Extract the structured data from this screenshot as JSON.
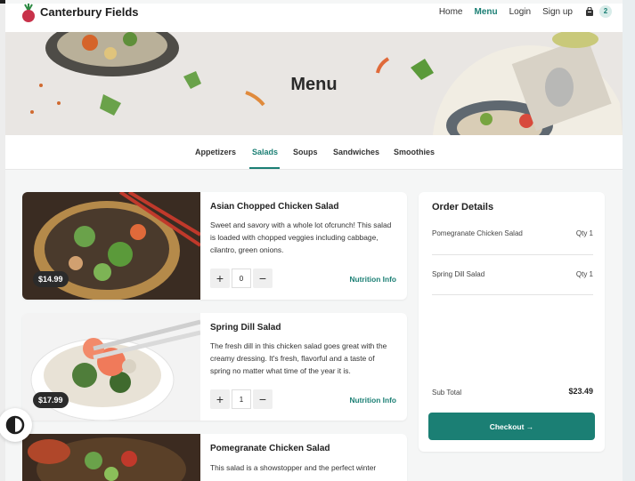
{
  "brand": {
    "name": "Canterbury Fields"
  },
  "nav": {
    "items": [
      "Home",
      "Menu",
      "Login",
      "Sign up"
    ],
    "active": "Menu",
    "cart_count": "2"
  },
  "hero": {
    "title": "Menu"
  },
  "tabs": {
    "items": [
      "Appetizers",
      "Salads",
      "Soups",
      "Sandwiches",
      "Smoothies"
    ],
    "active": "Salads"
  },
  "items": [
    {
      "title": "Asian Chopped Chicken Salad",
      "description": "Sweet and savory with a whole lot ofcrunch! This salad is loaded with chopped veggies including cabbage, cilantro, green onions.",
      "price": "$14.99",
      "qty": "0",
      "nutrition_label": "Nutrition Info"
    },
    {
      "title": "Spring Dill Salad",
      "description": "The fresh dill in this chicken salad goes great with the creamy dressing. It's fresh, flavorful and a taste of spring no matter what time of the year it is.",
      "price": "$17.99",
      "qty": "1",
      "nutrition_label": "Nutrition Info"
    },
    {
      "title": "Pomegranate Chicken Salad",
      "description": "This salad is a showstopper and the perfect winter"
    }
  ],
  "order": {
    "title": "Order Details",
    "lines": [
      {
        "name": "Pomegranate Chicken Salad",
        "qty": "Qty  1"
      },
      {
        "name": "Spring Dill Salad",
        "qty": "Qty  1"
      }
    ],
    "subtotal_label": "Sub Total",
    "subtotal_value": "$23.49",
    "checkout_label": "Checkout →"
  },
  "colors": {
    "accent": "#1b7f74",
    "price_pill": "#2b2b2b"
  }
}
